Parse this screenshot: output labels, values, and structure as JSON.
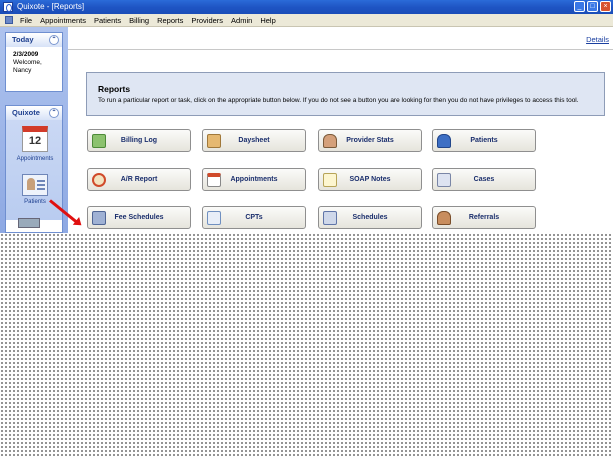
{
  "window": {
    "title": "Quixote - [Reports]"
  },
  "menu": {
    "items": [
      "File",
      "Appointments",
      "Patients",
      "Billing",
      "Reports",
      "Providers",
      "Admin",
      "Help"
    ]
  },
  "sidebar": {
    "today": {
      "heading": "Today",
      "date": "2/3/2009",
      "welcome": "Welcome,",
      "user": "Nancy"
    },
    "quixote": {
      "heading": "Quixote",
      "calendar_number": "12",
      "items": [
        {
          "label": "Appointments",
          "icon": "calendar-icon"
        },
        {
          "label": "Patients",
          "icon": "patients-icon"
        }
      ]
    }
  },
  "main": {
    "details_link": "Details",
    "reports_title": "Reports",
    "reports_description": "To run a particular report or task, click on the appropriate button below.  If you do not see a button you are looking for then you do not have privileges to access this tool.",
    "buttons": [
      {
        "label": "Billing Log",
        "icon": "billing-log-icon"
      },
      {
        "label": "Daysheet",
        "icon": "clipboard-icon"
      },
      {
        "label": "Provider Stats",
        "icon": "provider-icon"
      },
      {
        "label": "Patients",
        "icon": "patient-icon"
      },
      {
        "label": "A/R Report",
        "icon": "clock-icon"
      },
      {
        "label": "Appointments",
        "icon": "calendar-icon"
      },
      {
        "label": "SOAP Notes",
        "icon": "notes-icon"
      },
      {
        "label": "Cases",
        "icon": "cases-icon"
      },
      {
        "label": "Fee Schedules",
        "icon": "calculator-icon"
      },
      {
        "label": "CPTs",
        "icon": "star-icon"
      },
      {
        "label": "Schedules",
        "icon": "keyboard-icon"
      },
      {
        "label": "Referrals",
        "icon": "group-icon"
      }
    ]
  },
  "colors": {
    "titlebar": "#1f55c4",
    "sidebar": "#8ea9e3",
    "report_box": "#dfe6f3",
    "arrow": "#e01010"
  }
}
